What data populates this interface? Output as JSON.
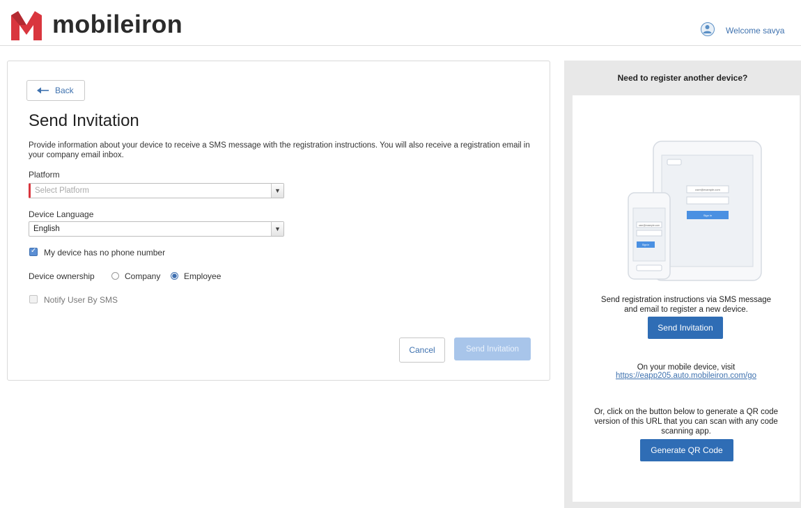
{
  "header": {
    "brand": "mobileiron",
    "welcome": "Welcome savya",
    "brand_color": "#d9363e"
  },
  "form": {
    "back_label": "Back",
    "title": "Send Invitation",
    "description": "Provide information about your device to receive a SMS message with the registration instructions. You will also receive a registration email in your company email inbox.",
    "platform_label": "Platform",
    "platform_placeholder": "Select Platform",
    "language_label": "Device Language",
    "language_value": "English",
    "no_phone_label": "My device has no phone number",
    "no_phone_checked": true,
    "ownership_label": "Device ownership",
    "ownership_options": [
      "Company",
      "Employee"
    ],
    "ownership_selected": "Employee",
    "notify_label": "Notify User By SMS",
    "notify_checked": false,
    "cancel_label": "Cancel",
    "send_label": "Send Invitation"
  },
  "side": {
    "heading": "Need to register another device?",
    "send_text": "Send registration instructions via SMS message and email to register a new device.",
    "send_button": "Send Invitation",
    "visit_text": "On your mobile device, visit",
    "visit_link": "https://eapp205.auto.mobileiron.com/go",
    "qr_text": "Or, click on the button below to generate a QR code version of this URL that you can scan with any code scanning app.",
    "qr_button": "Generate QR Code",
    "illus_tablet_field": "user@example.com",
    "illus_phone_field": "user@example.com",
    "illus_sign_in": "Sign in",
    "accent": "#2f6db5"
  }
}
